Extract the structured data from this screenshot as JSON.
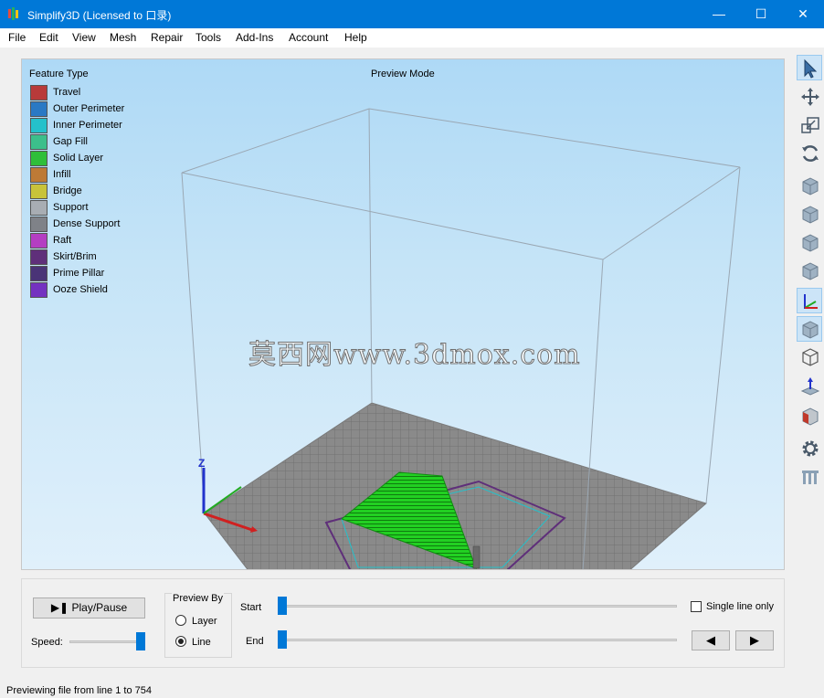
{
  "window": {
    "title": "Simplify3D (Licensed to 口录)",
    "minimize": "—",
    "maximize": "☐",
    "close": "✕"
  },
  "menu": [
    "File",
    "Edit",
    "View",
    "Mesh",
    "Repair",
    "Tools",
    "Add-Ins",
    "Account",
    "Help"
  ],
  "viewport": {
    "legend_title": "Feature Type",
    "preview_mode": "Preview Mode",
    "watermark": "莫西网www.3dmox.com",
    "axis_label": "Z",
    "legend": [
      {
        "label": "Travel",
        "color": "#b83a3a"
      },
      {
        "label": "Outer Perimeter",
        "color": "#2a79c4"
      },
      {
        "label": "Inner Perimeter",
        "color": "#24c1cb"
      },
      {
        "label": "Gap Fill",
        "color": "#3cbf8b"
      },
      {
        "label": "Solid Layer",
        "color": "#2fbf3a"
      },
      {
        "label": "Infill",
        "color": "#bd7a36"
      },
      {
        "label": "Bridge",
        "color": "#c8c33a"
      },
      {
        "label": "Support",
        "color": "#a8adb3"
      },
      {
        "label": "Dense Support",
        "color": "#7f8288"
      },
      {
        "label": "Raft",
        "color": "#b43ec2"
      },
      {
        "label": "Skirt/Brim",
        "color": "#5f2f7a"
      },
      {
        "label": "Prime Pillar",
        "color": "#4a3477"
      },
      {
        "label": "Ooze Shield",
        "color": "#7432c0"
      }
    ]
  },
  "toolbar_icons": [
    {
      "name": "select-icon",
      "active": true
    },
    {
      "name": "move-icon",
      "active": false
    },
    {
      "name": "scale-icon",
      "active": false
    },
    {
      "name": "rotate-icon",
      "active": false
    },
    {
      "name": "view-front-icon",
      "active": false
    },
    {
      "name": "view-top-icon",
      "active": false
    },
    {
      "name": "view-side-icon",
      "active": false
    },
    {
      "name": "view-iso-icon",
      "active": false
    },
    {
      "name": "axes-icon",
      "active": true
    },
    {
      "name": "solid-view-icon",
      "active": true
    },
    {
      "name": "wireframe-view-icon",
      "active": false
    },
    {
      "name": "build-plate-icon",
      "active": false
    },
    {
      "name": "cross-section-icon",
      "active": false
    },
    {
      "name": "settings-gear-icon",
      "active": false
    },
    {
      "name": "supports-icon",
      "active": false
    }
  ],
  "controls": {
    "play_pause": "Play/Pause",
    "speed_label": "Speed:",
    "preview_by_title": "Preview By",
    "option_layer": "Layer",
    "option_line": "Line",
    "selected_option": "Line",
    "start_label": "Start",
    "end_label": "End",
    "single_line_only": "Single line only",
    "single_line_checked": false,
    "prev_button": "◀",
    "next_button": "▶",
    "speed_value": 1.0,
    "start_value": 0.0,
    "end_value": 0.0
  },
  "status": {
    "text": "Previewing file from line 1 to 754"
  }
}
